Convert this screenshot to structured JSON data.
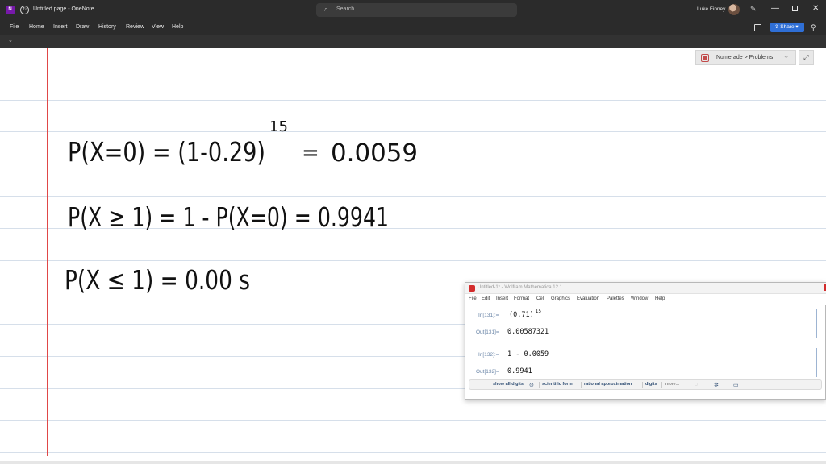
{
  "window": {
    "title": "Untitled page - OneNote",
    "search_placeholder": "Search",
    "user_name": "Luke Finney",
    "minimize_glyph": "—",
    "close_glyph": "✕"
  },
  "menu": {
    "items": [
      "File",
      "Home",
      "Insert",
      "Draw",
      "History",
      "Review",
      "View",
      "Help"
    ],
    "share_label": "Share"
  },
  "notebook_bar": {
    "label": "Numerade > Problems",
    "chevron": "⌵",
    "expand_glyph": "⤢"
  },
  "handwriting": {
    "line1": {
      "lhs": "P(X=0) = (1-0.29)",
      "exponent": "15",
      "eq": "=",
      "result": "0.0059"
    },
    "line2": {
      "text": "P(X ≥ 1) = 1 - P(X=0) = 0.9941"
    },
    "line3": {
      "text": "P(X ≤ 1) = 0.00 s"
    }
  },
  "mathematica": {
    "title": "Untitled-1* - Wolfram Mathematica 12.1",
    "menu": [
      "File",
      "Edit",
      "Insert",
      "Format",
      "Cell",
      "Graphics",
      "Evaluation",
      "Palettes",
      "Window",
      "Help"
    ],
    "cells": [
      {
        "label": "In[131]:=",
        "content": "(0.71)",
        "sup": "15"
      },
      {
        "label": "Out[131]=",
        "content": "0.00587321"
      },
      {
        "label": "In[132]:=",
        "content": "1 - 0.0059"
      },
      {
        "label": "Out[132]=",
        "content": "0.9941"
      }
    ],
    "suggestions": {
      "show_all_digits": "show all digits",
      "scientific_form": "scientific form",
      "rational_approximation": "rational approximation",
      "digits": "digits",
      "more": "more..."
    }
  },
  "colors": {
    "chrome": "#2b2b2b",
    "accent_onenote": "#7719aa",
    "share_blue": "#2f6fd6",
    "margin_red": "#e04848",
    "rule_blue": "#d6dfea",
    "mathematica_red": "#d32c2c"
  },
  "icons": [
    "onenote-app-icon",
    "sync-icon",
    "search-icon",
    "avatar",
    "pen-icon",
    "notebook-icon",
    "share-icon",
    "feedback-icon",
    "numerade-section-icon",
    "expand-icon",
    "mathematica-icon"
  ]
}
